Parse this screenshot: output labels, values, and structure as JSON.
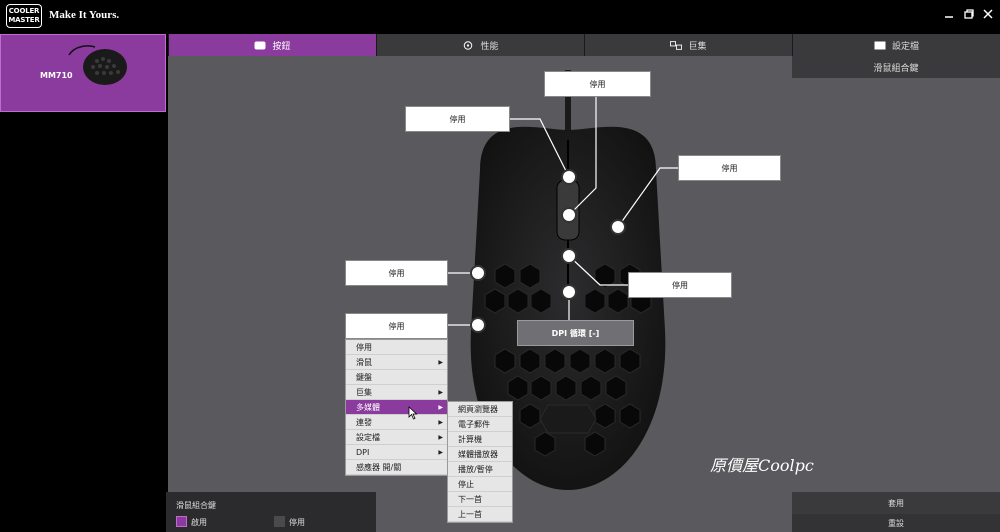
{
  "header": {
    "logo_line1": "COOLER",
    "logo_line2": "MASTER",
    "tagline": "Make It Yours."
  },
  "device": {
    "name": "MM710"
  },
  "tabs": [
    {
      "label": "按鈕",
      "icon": "mouse-buttons-icon",
      "active": true
    },
    {
      "label": "性能",
      "icon": "performance-icon",
      "active": false
    },
    {
      "label": "巨集",
      "icon": "macro-icon",
      "active": false
    },
    {
      "label": "設定檔",
      "icon": "profile-icon",
      "active": false
    }
  ],
  "combo_key_button": "滑鼠組合鍵",
  "callouts": {
    "top_center": "停用",
    "top_left": "停用",
    "right": "停用",
    "mid_left": "停用",
    "mid_right": "停用",
    "lower_left": "停用",
    "dpi": "DPI 循環 [-]"
  },
  "context_menu": {
    "items": [
      {
        "label": "停用",
        "has_submenu": false
      },
      {
        "label": "滑鼠",
        "has_submenu": true
      },
      {
        "label": "鍵盤",
        "has_submenu": false
      },
      {
        "label": "巨集",
        "has_submenu": true
      },
      {
        "label": "多媒體",
        "has_submenu": true,
        "selected": true
      },
      {
        "label": "連發",
        "has_submenu": true
      },
      {
        "label": "設定檔",
        "has_submenu": true
      },
      {
        "label": "DPI",
        "has_submenu": true
      },
      {
        "label": "感應器 開/關",
        "has_submenu": false
      }
    ],
    "submenu": [
      "網頁瀏覽器",
      "電子郵件",
      "計算機",
      "媒體播放器",
      "播放/暫停",
      "停止",
      "下一首",
      "上一首"
    ]
  },
  "legend": {
    "title": "滑鼠組合鍵",
    "enabled_label": "啟用",
    "disabled_label": "停用",
    "enabled_color": "#8b3a9e",
    "disabled_color": "#4a4a4c"
  },
  "actions": {
    "apply": "套用",
    "reset": "重設"
  },
  "watermark": "原價屋Coolpc",
  "colors": {
    "accent": "#8b3a9e",
    "panel": "#5a5a5e",
    "tab_bg": "#3a3a3c"
  }
}
